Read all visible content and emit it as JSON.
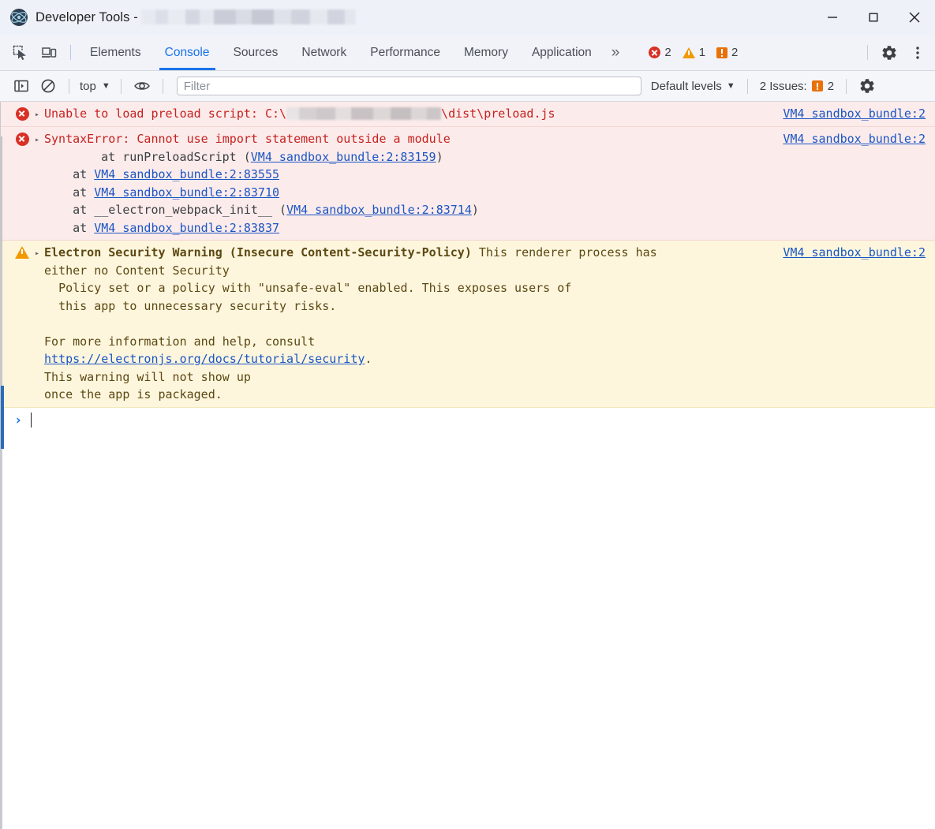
{
  "window": {
    "app_icon": "electron-logo-icon",
    "title_prefix": "Developer Tools -",
    "title_redacted": true,
    "controls": {
      "minimize": "minimize-icon",
      "maximize": "maximize-icon",
      "close": "close-icon"
    }
  },
  "tabstrip": {
    "left_icons": [
      "inspect-element-icon",
      "device-toolbar-icon"
    ],
    "tabs": [
      {
        "label": "Elements",
        "active": false
      },
      {
        "label": "Console",
        "active": true
      },
      {
        "label": "Sources",
        "active": false
      },
      {
        "label": "Network",
        "active": false
      },
      {
        "label": "Performance",
        "active": false
      },
      {
        "label": "Memory",
        "active": false
      },
      {
        "label": "Application",
        "active": false
      }
    ],
    "more_tabs_label": "»",
    "counters": {
      "errors": "2",
      "warnings": "1",
      "issues": "2"
    },
    "right_icons": [
      "settings-gear-icon",
      "more-options-icon"
    ]
  },
  "console_toolbar": {
    "sidebar_toggle": "console-sidebar-icon",
    "clear_console": "clear-console-icon",
    "context": "top",
    "context_caret": "▼",
    "live_expression": "eye-icon",
    "filter_placeholder": "Filter",
    "filter_value": "",
    "levels_label": "Default levels",
    "levels_caret": "▼",
    "issues_label": "2 Issues:",
    "issues_count": "2",
    "settings_icon": "console-settings-gear-icon"
  },
  "messages": [
    {
      "type": "error",
      "icon": "error-icon",
      "disclosure": "▸",
      "text_before": "Unable to load preload script: C:\\",
      "redacted": true,
      "text_after": "\\dist\\preload.js",
      "source": "VM4 sandbox_bundle:2"
    },
    {
      "type": "error",
      "icon": "error-icon",
      "disclosure": "▸",
      "title": "SyntaxError: Cannot use import statement outside a module",
      "source": "VM4 sandbox_bundle:2",
      "stack": [
        {
          "prefix": "    at runPreloadScript (",
          "link": "VM4 sandbox_bundle:2:83159",
          "suffix": ")"
        },
        {
          "prefix": "    at ",
          "link": "VM4 sandbox_bundle:2:83555",
          "suffix": ""
        },
        {
          "prefix": "    at ",
          "link": "VM4 sandbox_bundle:2:83710",
          "suffix": ""
        },
        {
          "prefix": "    at __electron_webpack_init__ (",
          "link": "VM4 sandbox_bundle:2:83714",
          "suffix": ")"
        },
        {
          "prefix": "    at ",
          "link": "VM4 sandbox_bundle:2:83837",
          "suffix": ""
        }
      ]
    },
    {
      "type": "warning",
      "icon": "warning-icon",
      "disclosure": "▸",
      "title": "Electron Security Warning (Insecure Content-Security-Policy)",
      "title_rest": " This renderer process has",
      "source": "VM4 sandbox_bundle:2",
      "body_lines": [
        "either no Content Security",
        "  Policy set or a policy with \"unsafe-eval\" enabled. This exposes users of",
        "  this app to unnecessary security risks.",
        "",
        "For more information and help, consult"
      ],
      "link_text": "https://electronjs.org/docs/tutorial/security",
      "link_suffix": ".",
      "tail_lines": [
        "This warning will not show up",
        "once the app is packaged."
      ]
    }
  ],
  "prompt": {
    "caret": "›",
    "value": ""
  },
  "colors": {
    "accent": "#1a73e8",
    "error_bg": "#fcebeb",
    "error_text": "#c5221f",
    "warning_bg": "#fdf6dd",
    "warning_text": "#5c4813",
    "link": "#1a56c4",
    "titlebar_bg": "#eef1f8",
    "toolbar_bg": "#f1f3f9"
  }
}
